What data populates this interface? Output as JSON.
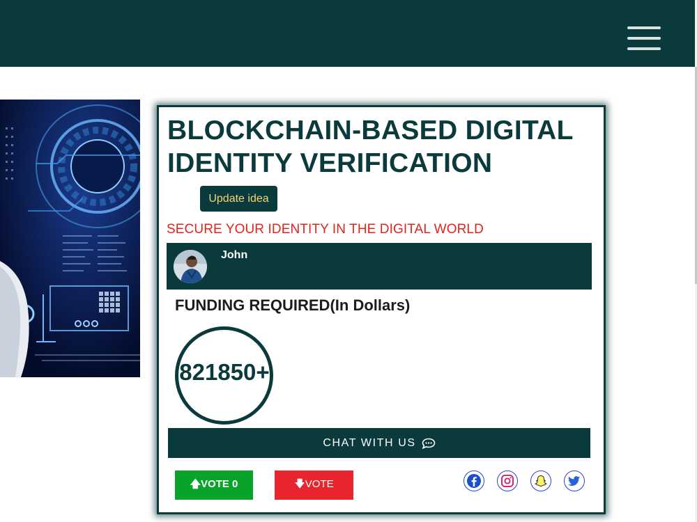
{
  "header": {
    "menu_icon": "hamburger-menu-icon",
    "background": "#0b3a3c"
  },
  "idea": {
    "title": "BLOCKCHAIN-BASED DIGITAL IDENTITY VERIFICATION",
    "update_label": "Update idea",
    "tagline": "SECURE YOUR IDENTITY IN THE DIGITAL WORLD",
    "author": "John",
    "funding_label": "FUNDING REQUIRED(In Dollars)",
    "funding_value": "821850+",
    "chat_label": "CHAT WITH US",
    "upvote_label": "VOTE",
    "upvote_count": "0",
    "downvote_label": "VOTE"
  },
  "colors": {
    "brand": "#0b3a3c",
    "tagline": "#e2241c",
    "update_text": "#f2d675",
    "upvote": "#0aa32a",
    "downvote": "#e8242f",
    "social_border": "#2d3fd6"
  },
  "social": [
    "facebook-icon",
    "instagram-icon",
    "snapchat-icon",
    "twitter-icon"
  ]
}
